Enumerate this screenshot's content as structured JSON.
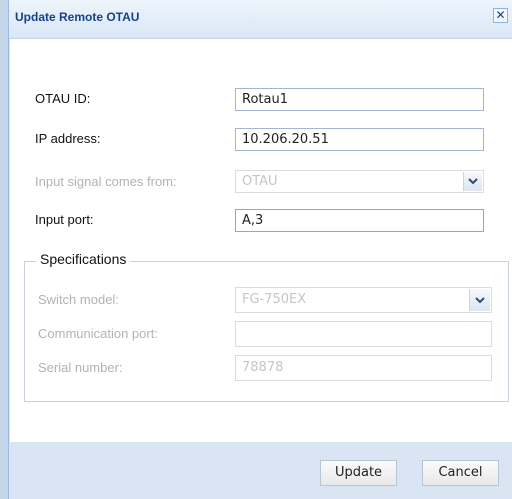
{
  "dialog": {
    "title": "Update Remote OTAU",
    "close_glyph": "✕"
  },
  "form": {
    "otau_id": {
      "label": "OTAU ID:",
      "value": "Rotau1"
    },
    "ip_address": {
      "label": "IP address:",
      "value": "10.206.20.51"
    },
    "input_signal": {
      "label": "Input signal comes from:",
      "value": "OTAU",
      "disabled": true
    },
    "input_port": {
      "label": "Input port:",
      "value": "A,3"
    }
  },
  "specifications": {
    "legend": "Specifications",
    "switch_model": {
      "label": "Switch model:",
      "value": "FG-750EX",
      "disabled": true
    },
    "communication_port": {
      "label": "Communication port:",
      "value": "",
      "disabled": true
    },
    "serial_number": {
      "label": "Serial number:",
      "value": "78878",
      "disabled": true
    }
  },
  "buttons": {
    "update": "Update",
    "cancel": "Cancel"
  },
  "colors": {
    "title_text": "#15428b",
    "frame": "#d9e5f3",
    "disabled_text": "#b3b3b3"
  },
  "icons": {
    "close": "close-icon",
    "dropdown": "chevron-down-icon"
  }
}
